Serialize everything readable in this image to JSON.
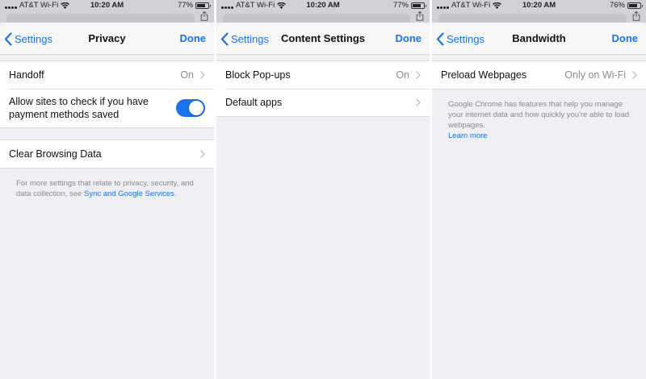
{
  "status_bar": {
    "carrier": "AT&T Wi-Fi",
    "time": "10:20 AM"
  },
  "colors": {
    "accent": "#1a73e8",
    "secondary_text": "#8e8e93",
    "background": "#efeff4"
  },
  "panels": [
    {
      "battery_text": "77%",
      "battery_level": 0.77,
      "nav": {
        "back_label": "Settings",
        "title": "Privacy",
        "done_label": "Done"
      },
      "rows": {
        "handoff": {
          "label": "Handoff",
          "value": "On"
        },
        "payment_methods": {
          "label": "Allow sites to check if you have payment methods saved",
          "toggle_on": true
        },
        "clear_browsing": {
          "label": "Clear Browsing Data"
        }
      },
      "footer": {
        "text": "For more settings that relate to privacy, security, and data collection, see ",
        "link": "Sync and Google Services",
        "suffix": "."
      }
    },
    {
      "battery_text": "77%",
      "battery_level": 0.77,
      "nav": {
        "back_label": "Settings",
        "title": "Content Settings",
        "done_label": "Done"
      },
      "rows": {
        "block_popups": {
          "label": "Block Pop-ups",
          "value": "On"
        },
        "default_apps": {
          "label": "Default apps"
        }
      }
    },
    {
      "battery_text": "76%",
      "battery_level": 0.76,
      "nav": {
        "back_label": "Settings",
        "title": "Bandwidth",
        "done_label": "Done"
      },
      "rows": {
        "preload": {
          "label": "Preload Webpages",
          "value": "Only on Wi-Fi"
        }
      },
      "footer": {
        "text": "Google Chrome has features that help you manage your internet data and how quickly you're able to load webpages.",
        "link": "Learn more"
      }
    }
  ],
  "icons": {
    "back": "chevron-left-icon",
    "disclosure": "chevron-right-icon",
    "wifi": "wifi-icon",
    "battery": "battery-icon",
    "share": "share-icon"
  }
}
